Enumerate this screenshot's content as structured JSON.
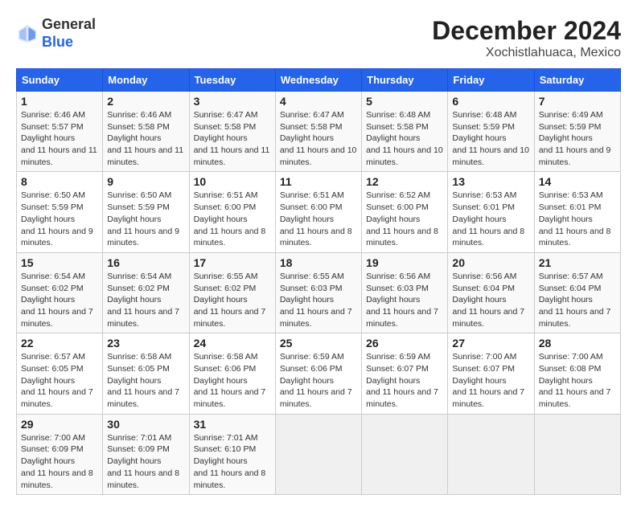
{
  "header": {
    "logo_line1": "General",
    "logo_line2": "Blue",
    "title": "December 2024",
    "subtitle": "Xochistlahuaca, Mexico"
  },
  "calendar": {
    "days_of_week": [
      "Sunday",
      "Monday",
      "Tuesday",
      "Wednesday",
      "Thursday",
      "Friday",
      "Saturday"
    ],
    "weeks": [
      [
        {
          "day": 1,
          "sunrise": "6:46 AM",
          "sunset": "5:57 PM",
          "daylight": "11 hours and 11 minutes."
        },
        {
          "day": 2,
          "sunrise": "6:46 AM",
          "sunset": "5:58 PM",
          "daylight": "11 hours and 11 minutes."
        },
        {
          "day": 3,
          "sunrise": "6:47 AM",
          "sunset": "5:58 PM",
          "daylight": "11 hours and 11 minutes."
        },
        {
          "day": 4,
          "sunrise": "6:47 AM",
          "sunset": "5:58 PM",
          "daylight": "11 hours and 10 minutes."
        },
        {
          "day": 5,
          "sunrise": "6:48 AM",
          "sunset": "5:58 PM",
          "daylight": "11 hours and 10 minutes."
        },
        {
          "day": 6,
          "sunrise": "6:48 AM",
          "sunset": "5:59 PM",
          "daylight": "11 hours and 10 minutes."
        },
        {
          "day": 7,
          "sunrise": "6:49 AM",
          "sunset": "5:59 PM",
          "daylight": "11 hours and 9 minutes."
        }
      ],
      [
        {
          "day": 8,
          "sunrise": "6:50 AM",
          "sunset": "5:59 PM",
          "daylight": "11 hours and 9 minutes."
        },
        {
          "day": 9,
          "sunrise": "6:50 AM",
          "sunset": "5:59 PM",
          "daylight": "11 hours and 9 minutes."
        },
        {
          "day": 10,
          "sunrise": "6:51 AM",
          "sunset": "6:00 PM",
          "daylight": "11 hours and 8 minutes."
        },
        {
          "day": 11,
          "sunrise": "6:51 AM",
          "sunset": "6:00 PM",
          "daylight": "11 hours and 8 minutes."
        },
        {
          "day": 12,
          "sunrise": "6:52 AM",
          "sunset": "6:00 PM",
          "daylight": "11 hours and 8 minutes."
        },
        {
          "day": 13,
          "sunrise": "6:53 AM",
          "sunset": "6:01 PM",
          "daylight": "11 hours and 8 minutes."
        },
        {
          "day": 14,
          "sunrise": "6:53 AM",
          "sunset": "6:01 PM",
          "daylight": "11 hours and 8 minutes."
        }
      ],
      [
        {
          "day": 15,
          "sunrise": "6:54 AM",
          "sunset": "6:02 PM",
          "daylight": "11 hours and 7 minutes."
        },
        {
          "day": 16,
          "sunrise": "6:54 AM",
          "sunset": "6:02 PM",
          "daylight": "11 hours and 7 minutes."
        },
        {
          "day": 17,
          "sunrise": "6:55 AM",
          "sunset": "6:02 PM",
          "daylight": "11 hours and 7 minutes."
        },
        {
          "day": 18,
          "sunrise": "6:55 AM",
          "sunset": "6:03 PM",
          "daylight": "11 hours and 7 minutes."
        },
        {
          "day": 19,
          "sunrise": "6:56 AM",
          "sunset": "6:03 PM",
          "daylight": "11 hours and 7 minutes."
        },
        {
          "day": 20,
          "sunrise": "6:56 AM",
          "sunset": "6:04 PM",
          "daylight": "11 hours and 7 minutes."
        },
        {
          "day": 21,
          "sunrise": "6:57 AM",
          "sunset": "6:04 PM",
          "daylight": "11 hours and 7 minutes."
        }
      ],
      [
        {
          "day": 22,
          "sunrise": "6:57 AM",
          "sunset": "6:05 PM",
          "daylight": "11 hours and 7 minutes."
        },
        {
          "day": 23,
          "sunrise": "6:58 AM",
          "sunset": "6:05 PM",
          "daylight": "11 hours and 7 minutes."
        },
        {
          "day": 24,
          "sunrise": "6:58 AM",
          "sunset": "6:06 PM",
          "daylight": "11 hours and 7 minutes."
        },
        {
          "day": 25,
          "sunrise": "6:59 AM",
          "sunset": "6:06 PM",
          "daylight": "11 hours and 7 minutes."
        },
        {
          "day": 26,
          "sunrise": "6:59 AM",
          "sunset": "6:07 PM",
          "daylight": "11 hours and 7 minutes."
        },
        {
          "day": 27,
          "sunrise": "7:00 AM",
          "sunset": "6:07 PM",
          "daylight": "11 hours and 7 minutes."
        },
        {
          "day": 28,
          "sunrise": "7:00 AM",
          "sunset": "6:08 PM",
          "daylight": "11 hours and 7 minutes."
        }
      ],
      [
        {
          "day": 29,
          "sunrise": "7:00 AM",
          "sunset": "6:09 PM",
          "daylight": "11 hours and 8 minutes."
        },
        {
          "day": 30,
          "sunrise": "7:01 AM",
          "sunset": "6:09 PM",
          "daylight": "11 hours and 8 minutes."
        },
        {
          "day": 31,
          "sunrise": "7:01 AM",
          "sunset": "6:10 PM",
          "daylight": "11 hours and 8 minutes."
        },
        null,
        null,
        null,
        null
      ]
    ]
  }
}
